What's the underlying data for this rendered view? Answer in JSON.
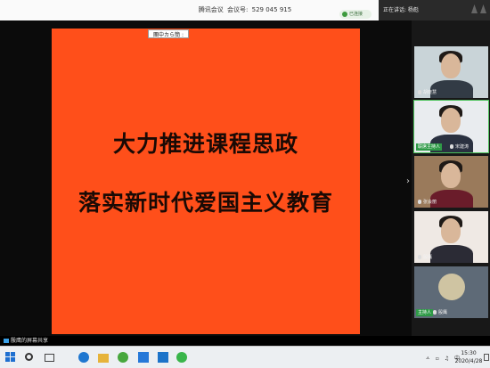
{
  "header": {
    "app_name": "腾讯会议",
    "meeting_id_label": "会议号:",
    "meeting_id": "529 045 915",
    "wechat_badge": "已连接"
  },
  "speaking": {
    "label": "正在讲话: 杨彪"
  },
  "slide": {
    "toolbar": "團中カら簡 :",
    "line1": "大力推进课程思政",
    "line2": "落实新时代爱国主义教育",
    "background_color": "#ff4f1a"
  },
  "participants": [
    {
      "name": "胡晓慧",
      "host": false
    },
    {
      "name": "宋建涛",
      "host": true,
      "host_label": "联席主持人"
    },
    {
      "name": "张会丽",
      "host": false
    },
    {
      "name": "殷鹰",
      "host": false
    },
    {
      "name": "殷鹰",
      "host": true,
      "host_label": "主持人"
    }
  ],
  "share_status": "殷鹰的屏幕共享",
  "taskbar": {
    "time": "15:30",
    "date": "2020/4/28",
    "tray_text": "ㅅ ▫ ♫ 中"
  }
}
